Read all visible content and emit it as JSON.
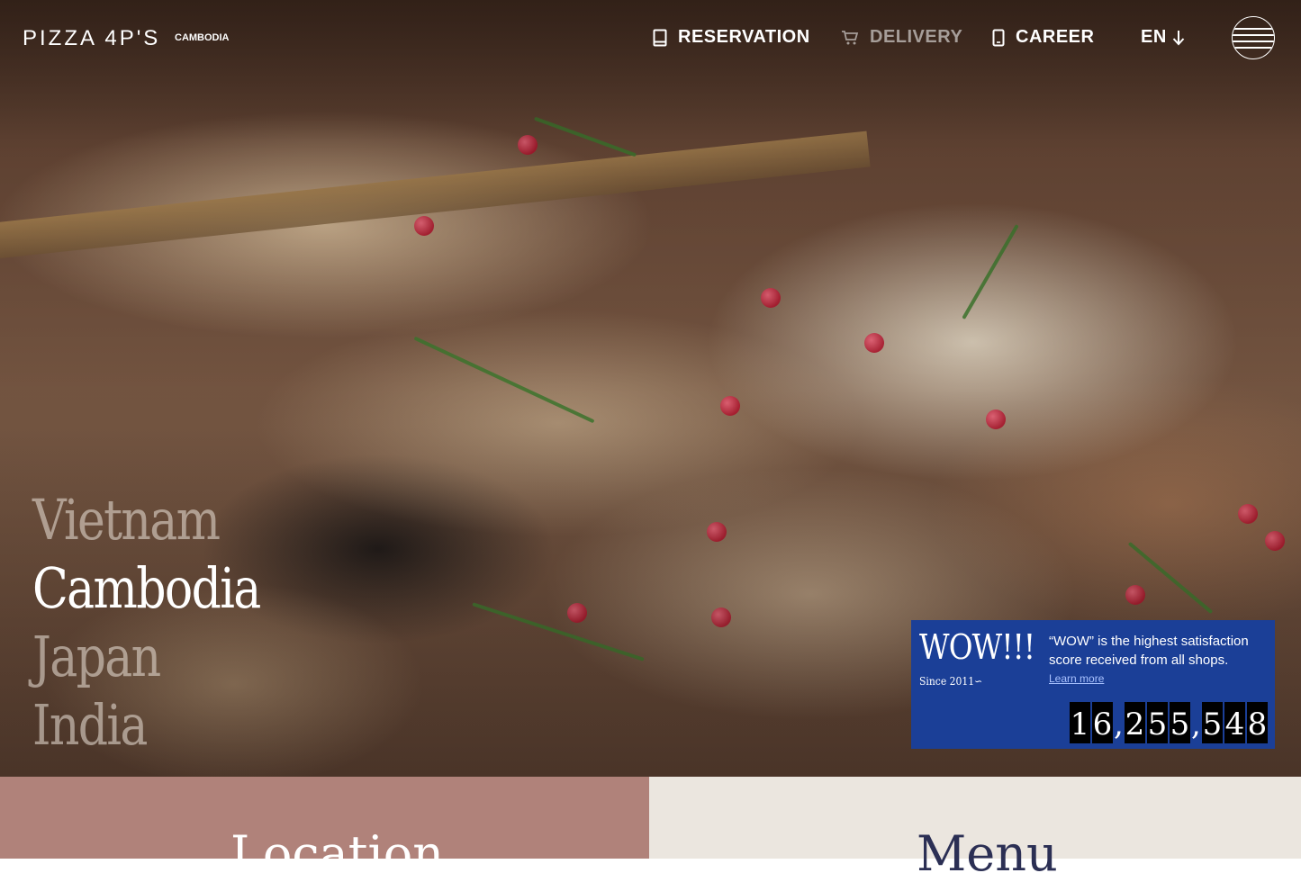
{
  "header": {
    "logo": "PIZZA 4P'S",
    "logo_sub": "CAMBODIA",
    "nav": {
      "reservation": "RESERVATION",
      "delivery": "DELIVERY",
      "career": "CAREER"
    },
    "language": "EN"
  },
  "hero": {
    "countries": [
      "Vietnam",
      "Cambodia",
      "Japan",
      "India"
    ],
    "active_country": "Cambodia"
  },
  "wow_card": {
    "title": "WOW!!!",
    "since": "Since 2011∽",
    "description": "“WOW” is the highest satisfaction score received from all shops.",
    "link": "Learn more",
    "count": "16,255,548"
  },
  "sections": {
    "location": "Location",
    "menu": "Menu"
  },
  "colors": {
    "card_blue": "#1b3f97",
    "location_bg": "#b0827a",
    "menu_bg": "#ebe6df",
    "menu_text": "#2b2f54"
  }
}
